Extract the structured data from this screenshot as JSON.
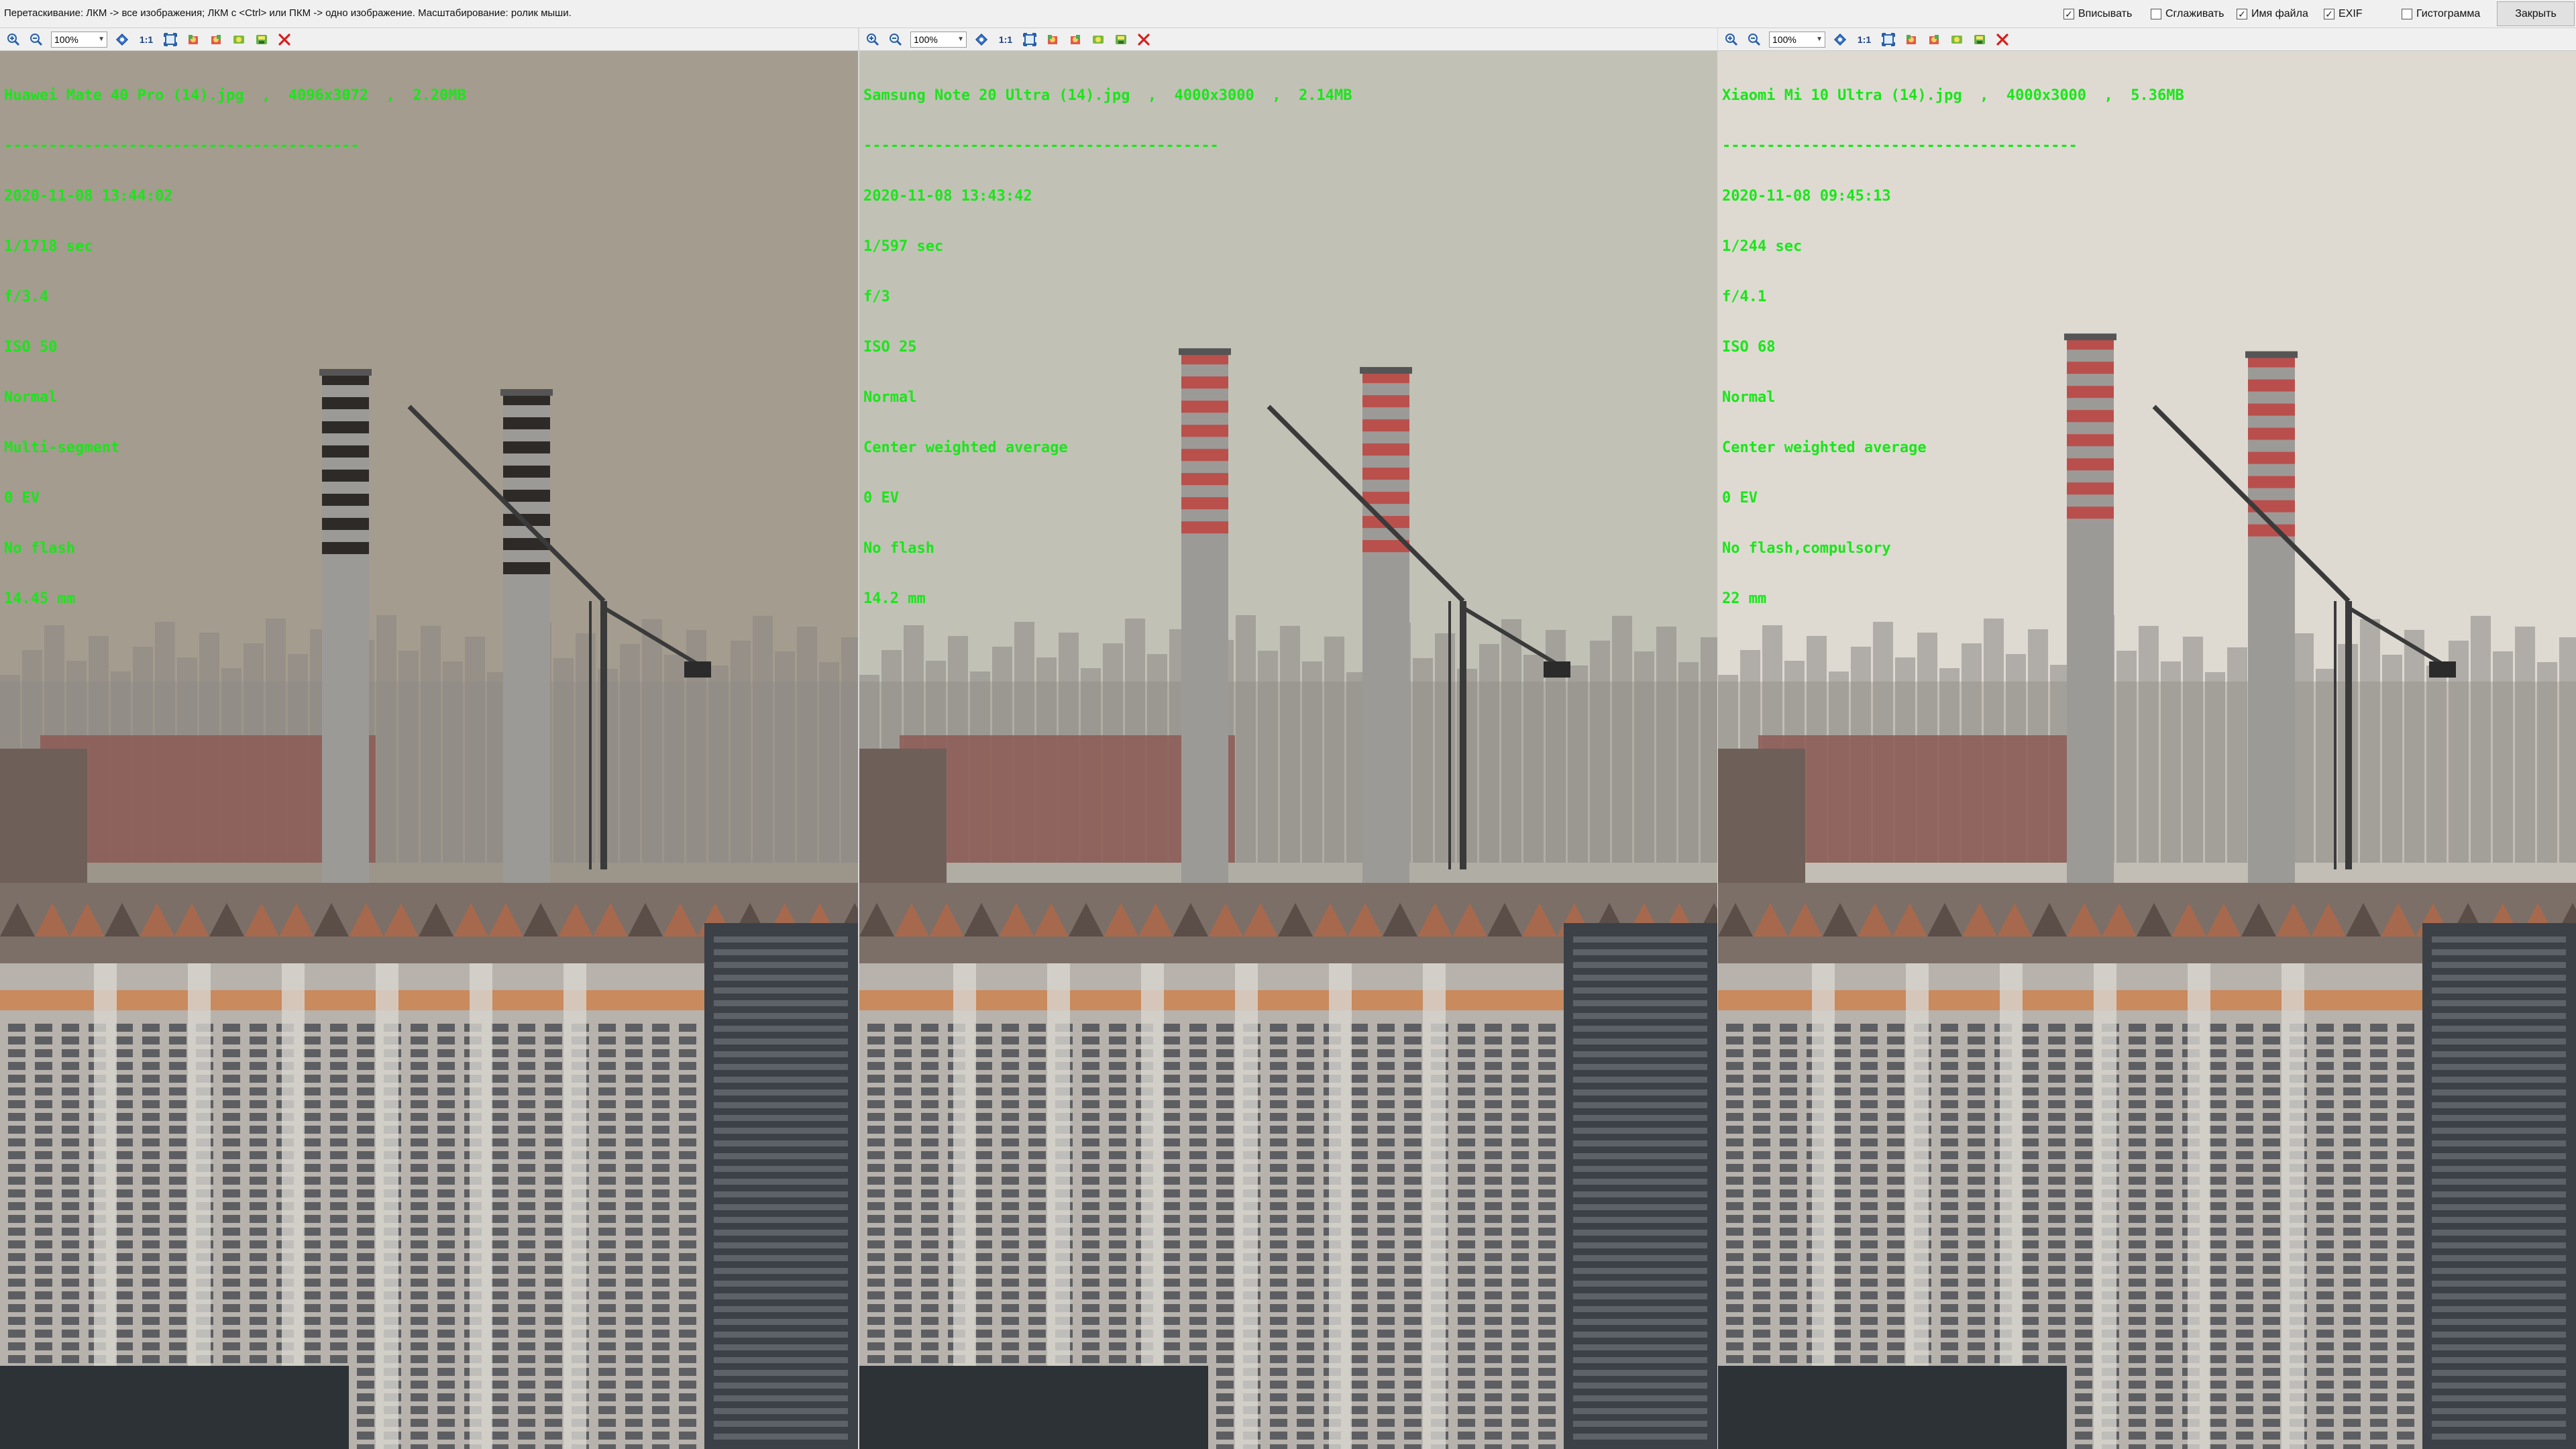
{
  "topbar": {
    "hint": "Перетаскивание: ЛКМ -> все изображения; ЛКМ с <Ctrl> или ПКМ -> одно изображение. Масштабирование: ролик мыши.",
    "options": [
      {
        "label": "Вписывать",
        "checked": true
      },
      {
        "label": "Сглаживать",
        "checked": false
      },
      {
        "label": "Имя файла",
        "checked": true
      },
      {
        "label": "EXIF",
        "checked": true
      },
      {
        "label": "Гистограмма",
        "checked": false
      }
    ],
    "close_label": "Закрыть"
  },
  "zoom_value": "100%",
  "one_to_one": "1:1",
  "panes": [
    {
      "title": "Huawei Mate 40 Pro (14).jpg  ,  4096x3072  ,  2.20MB",
      "separator": "----------------------------------------",
      "datetime": "2020-11-08 13:44:02",
      "shutter": "1/1718 sec",
      "aperture": "f/3.4",
      "iso": "ISO 50",
      "mode": "Normal",
      "metering": "Multi-segment",
      "ev": "0 EV",
      "flash": "No flash",
      "focal": "14.45 mm"
    },
    {
      "title": "Samsung Note 20 Ultra (14).jpg  ,  4000x3000  ,  2.14MB",
      "separator": "----------------------------------------",
      "datetime": "2020-11-08 13:43:42",
      "shutter": "1/597 sec",
      "aperture": "f/3",
      "iso": "ISO 25",
      "mode": "Normal",
      "metering": "Center weighted average",
      "ev": "0 EV",
      "flash": "No flash",
      "focal": "14.2 mm"
    },
    {
      "title": "Xiaomi Mi 10 Ultra (14).jpg  ,  4000x3000  ,  5.36MB",
      "separator": "----------------------------------------",
      "datetime": "2020-11-08 09:45:13",
      "shutter": "1/244 sec",
      "aperture": "f/4.1",
      "iso": "ISO 68",
      "mode": "Normal",
      "metering": "Center weighted average",
      "ev": "0 EV",
      "flash": "No flash,compulsory",
      "focal": "22 mm"
    }
  ],
  "colors": {
    "exif_text": "#19e619",
    "sky": [
      "#a49c8e",
      "#c2c1b6",
      "#dedad2"
    ],
    "stripe": [
      "#2e2a28",
      "#b9504c",
      "#b94f4c"
    ]
  },
  "icons": [
    "zoom-in-icon",
    "zoom-out-icon",
    "fit-icon",
    "pan-icon",
    "rotate-left-icon",
    "rotate-right-icon",
    "compare-icon",
    "save-icon",
    "close-icon"
  ]
}
